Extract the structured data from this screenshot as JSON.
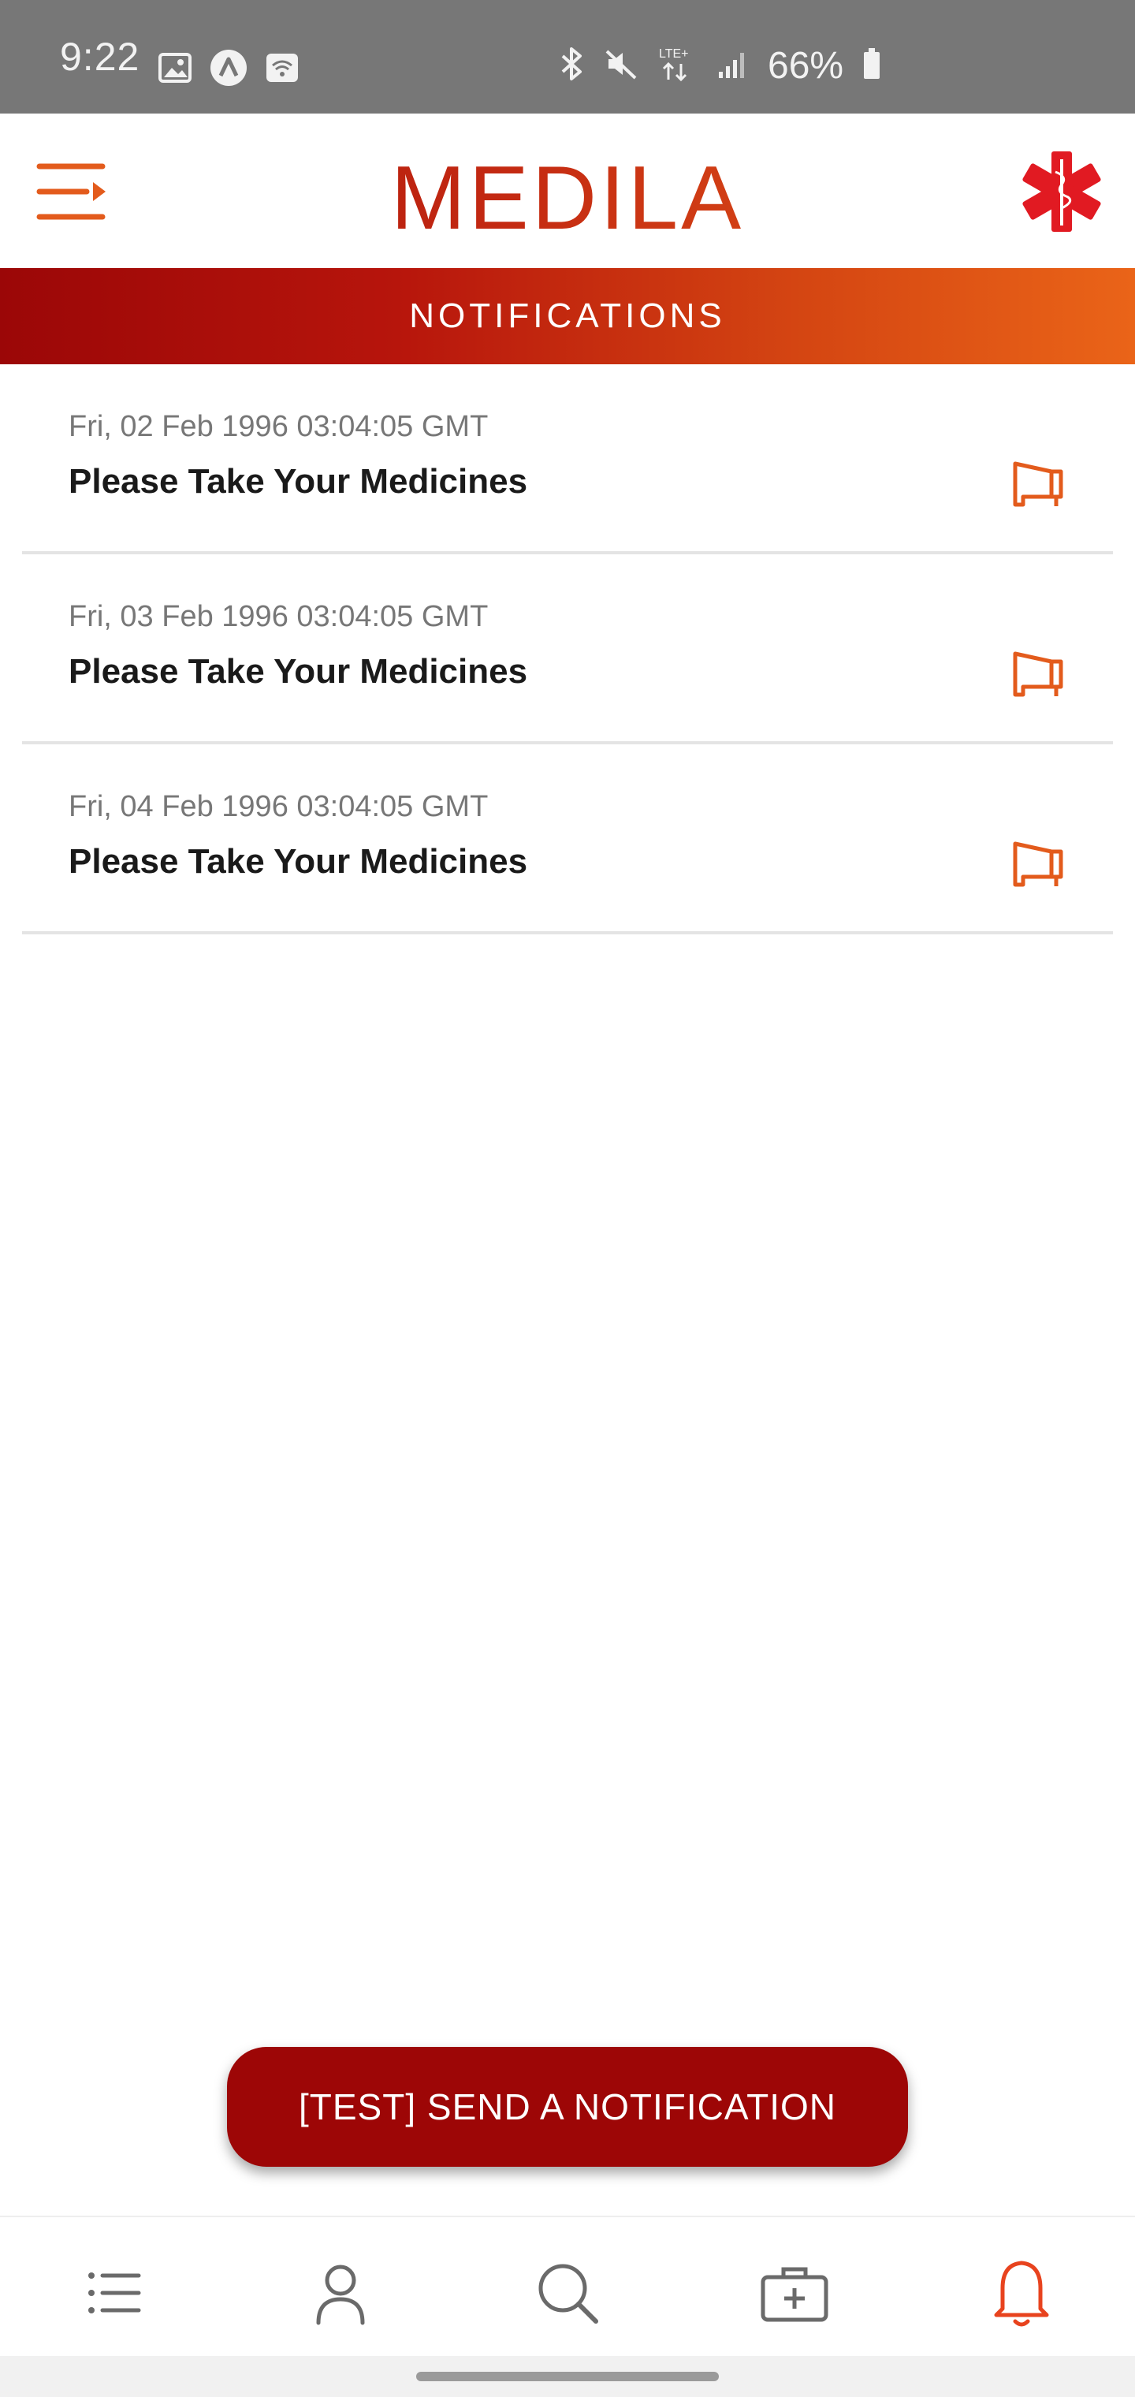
{
  "status_bar": {
    "time": "9:22",
    "battery": "66%",
    "network_label": "LTE+",
    "icons": [
      "image-icon",
      "app-a-icon",
      "wifi-hotspot-icon",
      "bluetooth-icon",
      "mute-icon",
      "lte-icon",
      "signal-icon",
      "battery-icon"
    ]
  },
  "header": {
    "brand": "MEDILA",
    "menu_icon": "menu-arrow-icon",
    "logo_icon": "star-of-life-icon"
  },
  "section": {
    "title": "NOTIFICATIONS"
  },
  "notifications": [
    {
      "date": "Fri, 02 Feb 1996 03:04:05 GMT",
      "title": "Please Take Your Medicines",
      "icon": "megaphone-icon"
    },
    {
      "date": "Fri, 03 Feb 1996 03:04:05 GMT",
      "title": "Please Take Your Medicines",
      "icon": "megaphone-icon"
    },
    {
      "date": "Fri, 04 Feb 1996 03:04:05 GMT",
      "title": "Please Take Your Medicines",
      "icon": "megaphone-icon"
    }
  ],
  "actions": {
    "test_button": "[TEST] SEND A NOTIFICATION"
  },
  "bottom_nav": {
    "items": [
      {
        "name": "list",
        "icon": "list-icon",
        "active": false
      },
      {
        "name": "profile",
        "icon": "user-icon",
        "active": false
      },
      {
        "name": "search",
        "icon": "search-icon",
        "active": false
      },
      {
        "name": "medical-kit",
        "icon": "medical-kit-icon",
        "active": false
      },
      {
        "name": "notifications",
        "icon": "bell-icon",
        "active": true
      }
    ]
  },
  "colors": {
    "brand_red": "#9d0606",
    "brand_orange": "#ea6418",
    "status_bar": "#777777",
    "icon_gray": "#6a6a6a",
    "active_nav": "#e8431e"
  }
}
